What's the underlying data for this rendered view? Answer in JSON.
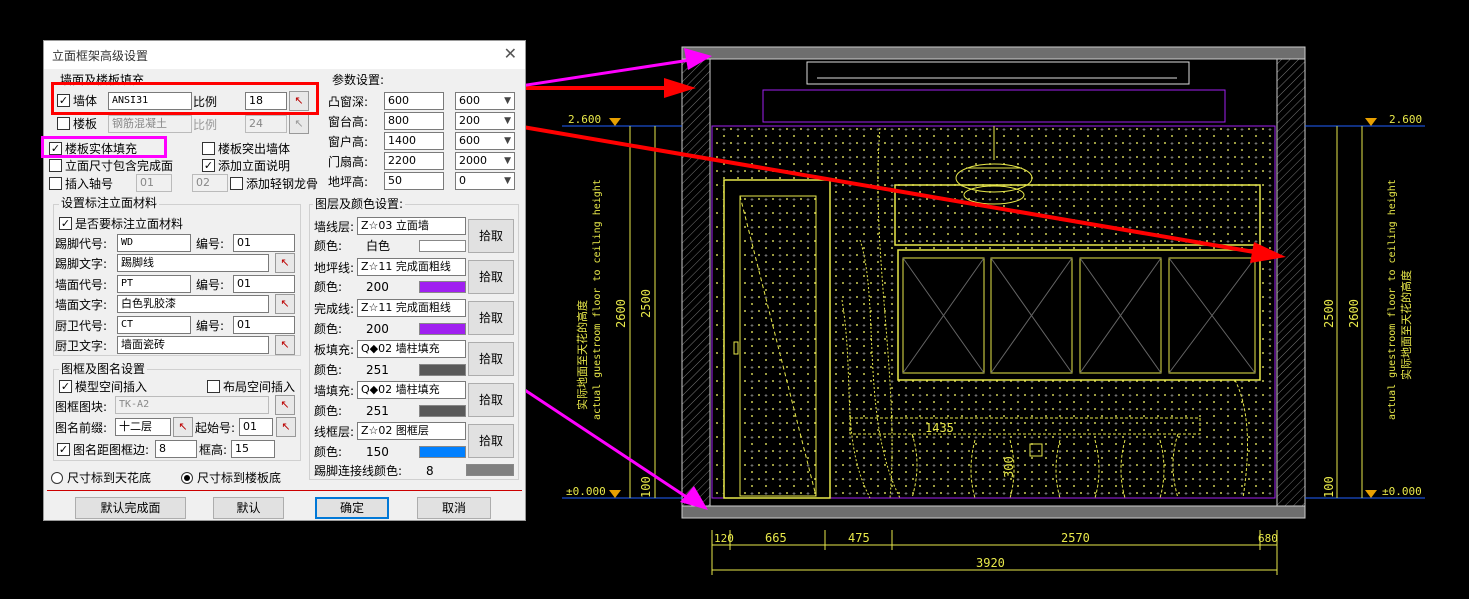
{
  "dialog": {
    "title": "立面框架高级设置",
    "close": "✕",
    "wall_fill": {
      "title": "墙面及楼板填充",
      "wall_label": "墙体",
      "wall_checked": "✓",
      "wall_hatch": "ANSI31",
      "wall_ratio_label": "比例",
      "wall_ratio": "18",
      "slab_label": "楼板",
      "slab_checked": "",
      "slab_material": "钢筋混凝土",
      "slab_ratio_label": "比例",
      "slab_ratio": "24"
    },
    "options": {
      "slab_solid_fill": "楼板实体填充",
      "slab_solid_fill_checked": "✓",
      "slab_protrude": "楼板突出墙体",
      "slab_protrude_checked": "",
      "include_finish": "立面尺寸包含完成面",
      "include_finish_checked": "",
      "add_note": "添加立面说明",
      "add_note_checked": "✓",
      "insert_axis": "插入轴号",
      "insert_axis_checked": "",
      "axis_from": "01",
      "axis_to": "02",
      "add_keel": "添加轻钢龙骨",
      "add_keel_checked": ""
    },
    "params": {
      "title": "参数设置:",
      "rows": [
        {
          "label": "凸窗深:",
          "value": "600",
          "combo": "600"
        },
        {
          "label": "窗台高:",
          "value": "800",
          "combo": "200"
        },
        {
          "label": "窗户高:",
          "value": "1400",
          "combo": "600"
        },
        {
          "label": "门扇高:",
          "value": "2200",
          "combo": "2000"
        },
        {
          "label": "地坪高:",
          "value": "50",
          "combo": "0"
        }
      ]
    },
    "material": {
      "title": "设置标注立面材料",
      "mark_material": "是否要标注立面材料",
      "mark_material_checked": "✓",
      "baseboard_code_label": "踢脚代号:",
      "baseboard_code": "WD",
      "baseboard_no_label": "编号:",
      "baseboard_no": "01",
      "baseboard_text_label": "踢脚文字:",
      "baseboard_text": "踢脚线",
      "wall_code_label": "墙面代号:",
      "wall_code": "PT",
      "wall_no_label": "编号:",
      "wall_no": "01",
      "wall_text_label": "墙面文字:",
      "wall_text": "白色乳胶漆",
      "kitchen_code_label": "厨卫代号:",
      "kitchen_code": "CT",
      "kitchen_no_label": "编号:",
      "kitchen_no": "01",
      "kitchen_text_label": "厨卫文字:",
      "kitchen_text": "墙面瓷砖"
    },
    "frame": {
      "title": "图框及图名设置",
      "model_space": "模型空间插入",
      "model_space_checked": "✓",
      "layout_space": "布局空间插入",
      "layout_space_checked": "",
      "block_label": "图框图块:",
      "block": "TK-A2",
      "prefix_label": "图名前缀:",
      "prefix": "十二层",
      "start_label": "起始号:",
      "start": "01",
      "margin_label": "图名距图框边:",
      "margin": "8",
      "margin_checked": "✓",
      "height_label": "框高:",
      "height": "15"
    },
    "radios": {
      "to_ceiling": "尺寸标到天花底",
      "to_ceiling_on": false,
      "to_slab": "尺寸标到楼板底",
      "to_slab_on": true
    },
    "layers": {
      "title": "图层及颜色设置:",
      "pick": "拾取",
      "color_label": "颜色:",
      "rows": [
        {
          "label": "墙线层:",
          "layer": "Z☆03 立面墙",
          "color": "白色",
          "swatch": "#ffffff"
        },
        {
          "label": "地坪线:",
          "layer": "Z☆11 完成面粗线",
          "color": "200",
          "swatch": "#a020f0"
        },
        {
          "label": "完成线:",
          "layer": "Z☆11 完成面粗线",
          "color": "200",
          "swatch": "#a020f0"
        },
        {
          "label": "板填充:",
          "layer": "Q◆02 墙柱填充",
          "color": "251",
          "swatch": "#5a5a5a"
        },
        {
          "label": "墙填充:",
          "layer": "Q◆02 墙柱填充",
          "color": "251",
          "swatch": "#5a5a5a"
        },
        {
          "label": "线框层:",
          "layer": "Z☆02 图框层",
          "color": "150",
          "swatch": "#0080ff"
        }
      ],
      "baseboard_color_label": "踢脚连接线颜色:",
      "baseboard_color": "8",
      "baseboard_swatch": "#808080"
    },
    "buttons": {
      "default_finish": "默认完成面",
      "default": "默认",
      "ok": "确定",
      "cancel": "取消"
    }
  },
  "cad": {
    "level_left_top": "2.600",
    "level_left_bottom": "±0.000",
    "level_right_top": "2.600",
    "level_right_bottom": "±0.000",
    "left_dim_outer": "2600",
    "left_dim_inner": "2500",
    "left_dim_small": "100",
    "right_dim_outer": "2600",
    "right_dim_inner": "2500",
    "right_dim_small": "100",
    "note_cn": "实际地面至天花的高度",
    "note_en": "actual guestroom floor to ceiling height",
    "center_dim": "1435",
    "center_dim2": "300",
    "bottom_dims": [
      "120",
      "665",
      "475",
      "2570",
      "680"
    ],
    "total_dim": "3920"
  },
  "colors": {
    "annotation_red": "#ff0000",
    "annotation_magenta": "#ff00ff",
    "cad_yellow": "#e8e84a",
    "cad_purple": "#a020f0"
  }
}
